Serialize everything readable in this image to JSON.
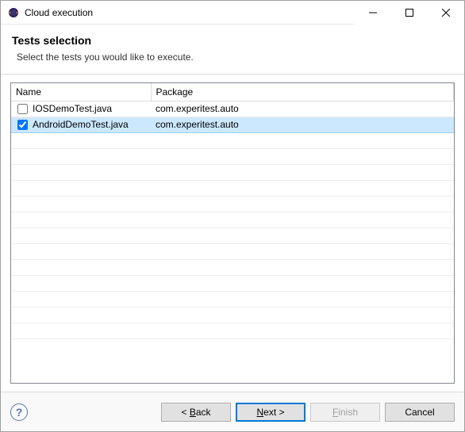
{
  "window": {
    "title": "Cloud execution"
  },
  "header": {
    "title": "Tests selection",
    "subtitle": "Select the tests you would like to execute."
  },
  "table": {
    "columns": {
      "name": "Name",
      "package": "Package"
    },
    "rows": [
      {
        "checked": false,
        "name": "IOSDemoTest.java",
        "package": "com.experitest.auto",
        "selected": false
      },
      {
        "checked": true,
        "name": "AndroidDemoTest.java",
        "package": "com.experitest.auto",
        "selected": true
      }
    ]
  },
  "buttons": {
    "back_prefix": "< ",
    "back_mnemonic": "B",
    "back_suffix": "ack",
    "next_mnemonic": "N",
    "next_suffix": "ext >",
    "finish_mnemonic": "F",
    "finish_suffix": "inish",
    "cancel": "Cancel"
  },
  "help": {
    "symbol": "?"
  }
}
